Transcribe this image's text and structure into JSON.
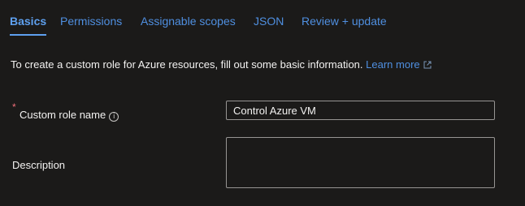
{
  "tabs": [
    {
      "label": "Basics",
      "active": true
    },
    {
      "label": "Permissions",
      "active": false
    },
    {
      "label": "Assignable scopes",
      "active": false
    },
    {
      "label": "JSON",
      "active": false
    },
    {
      "label": "Review + update",
      "active": false
    }
  ],
  "intro": {
    "text": "To create a custom role for Azure resources, fill out some basic information.",
    "learn_more": "Learn more",
    "external_link_icon": "external-link-icon"
  },
  "form": {
    "role_name": {
      "label": "Custom role name",
      "required_marker": "*",
      "info_icon": "info-icon",
      "value": "Control Azure VM"
    },
    "description": {
      "label": "Description",
      "value": ""
    }
  },
  "colors": {
    "background": "#1b1a19",
    "link": "#4f8fe0",
    "active_tab": "#5ea0ef",
    "text": "#f3f2f1",
    "required": "#f1707b",
    "input_border": "#979593"
  }
}
